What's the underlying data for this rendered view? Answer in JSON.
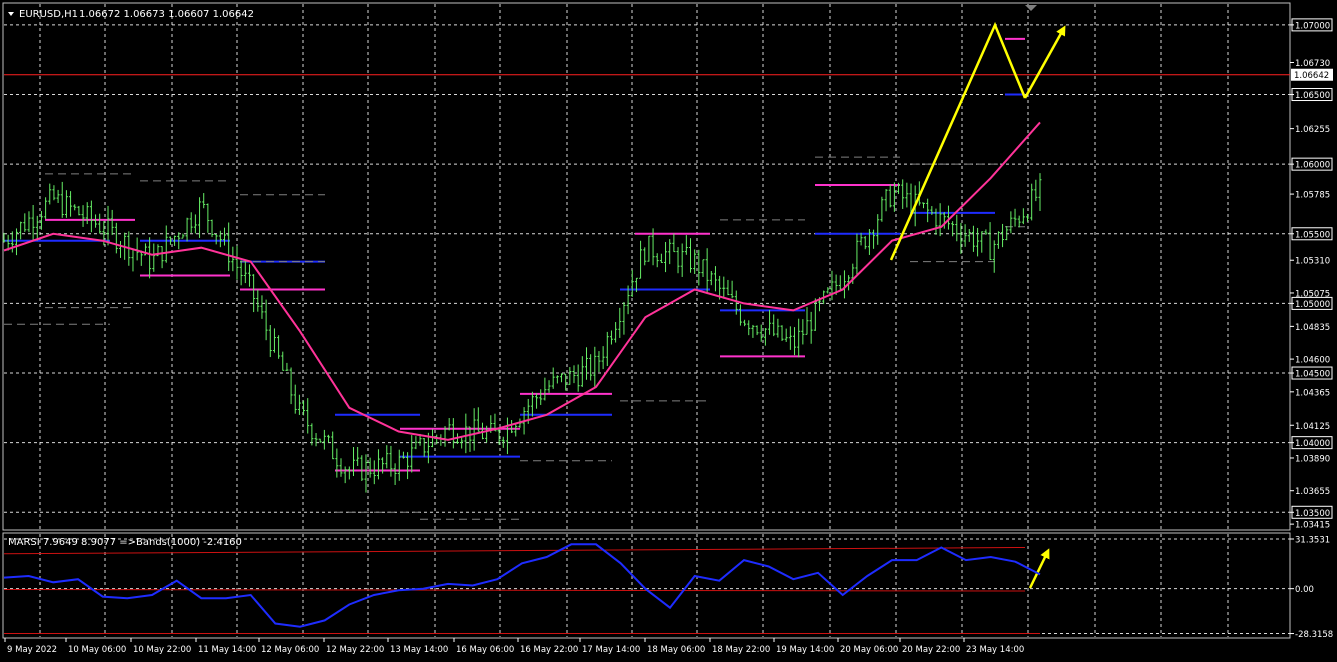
{
  "header": {
    "symbol": "EURUSD,H1",
    "ohlc": "1.06672 1.06673 1.06607 1.06642"
  },
  "colors": {
    "background": "#000000",
    "grid": "#ffffff",
    "candle": "#66ee66",
    "ma": "#ff3399",
    "level_magenta": "#ff33cc",
    "level_blue": "#1e2cff",
    "level_gray": "#808080",
    "arrow": "#ffff00",
    "bid_line": "#ff2020",
    "rsi": "#1e2cff",
    "band": "#cc1111"
  },
  "chart_data": [
    {
      "type": "candlestick",
      "title": "EURUSD,H1",
      "ylim": [
        1.0338,
        1.0715
      ],
      "x_ticks": [
        "9 May 2022",
        "10 May 06:00",
        "10 May 22:00",
        "11 May 14:00",
        "12 May 06:00",
        "12 May 22:00",
        "13 May 14:00",
        "16 May 06:00",
        "16 May 22:00",
        "17 May 14:00",
        "18 May 06:00",
        "18 May 22:00",
        "19 May 14:00",
        "20 May 06:00",
        "20 May 22:00",
        "23 May 14:00"
      ],
      "y_ticks": [
        "1.07000",
        "1.06730",
        "1.06500",
        "1.06255",
        "1.06000",
        "1.05785",
        "1.05500",
        "1.05310",
        "1.05075",
        "1.05000",
        "1.04835",
        "1.04600",
        "1.04500",
        "1.04365",
        "1.04125",
        "1.04000",
        "1.03890",
        "1.03655",
        "1.03500",
        "1.03415"
      ],
      "current_price": "1.06642",
      "x": [
        0,
        10,
        20,
        30,
        40,
        50,
        60,
        70,
        80,
        90,
        100,
        110,
        120,
        130,
        140,
        150,
        160,
        170,
        180,
        190,
        200,
        210
      ],
      "close": [
        1.0545,
        1.0575,
        1.0555,
        1.053,
        1.057,
        1.051,
        1.042,
        1.038,
        1.0385,
        1.041,
        1.0405,
        1.044,
        1.0455,
        1.054,
        1.053,
        1.049,
        1.047,
        1.052,
        1.058,
        1.056,
        1.054,
        1.058
      ],
      "series": [
        {
          "name": "",
          "type": "moving_average",
          "x": [
            0,
            10,
            20,
            30,
            40,
            50,
            60,
            70,
            80,
            90,
            100,
            110,
            120,
            130,
            140,
            150,
            160,
            170,
            180,
            190,
            200,
            210
          ],
          "values": [
            1.0538,
            1.055,
            1.0545,
            1.0535,
            1.054,
            1.053,
            1.048,
            1.0425,
            1.0408,
            1.0402,
            1.041,
            1.042,
            1.044,
            1.049,
            1.051,
            1.05,
            1.0495,
            1.051,
            1.0545,
            1.0555,
            1.059,
            1.063
          ]
        }
      ]
    },
    {
      "type": "line",
      "title": "MARSI 7.9649 8.9077  =>Bands(1000) -2.4160",
      "ylim": [
        -30.5,
        34.5
      ],
      "y_ticks": [
        "31.3531",
        "0.00",
        "-28.3158"
      ],
      "x": [
        0,
        5,
        10,
        15,
        20,
        25,
        30,
        35,
        40,
        45,
        50,
        55,
        60,
        65,
        70,
        75,
        80,
        85,
        90,
        95,
        100,
        105,
        110,
        115,
        120,
        125,
        130,
        135,
        140,
        145,
        150,
        155,
        160,
        165,
        170,
        175,
        180,
        185,
        190,
        195,
        200,
        205,
        210
      ],
      "series": [
        {
          "name": "",
          "values": [
            7,
            8,
            4,
            6,
            -5,
            -6,
            -4,
            5,
            -6,
            -6,
            -4,
            -22,
            -24,
            -20,
            -10,
            -4,
            -1,
            0,
            3,
            2,
            6,
            16,
            20,
            28,
            28,
            16,
            0,
            -12,
            8,
            5,
            18,
            14,
            6,
            10,
            -4,
            8,
            18,
            18,
            26,
            18,
            20,
            17,
            9
          ]
        },
        {
          "name": "",
          "values": [
            -28.3,
            -28.3,
            -28.3,
            -28.3,
            -28.3,
            -28.3,
            -28.3,
            -28.3,
            -28.3,
            -28.3,
            -28.3,
            -28.3,
            -28.3,
            -28.3,
            -28.3,
            -28.3,
            -28.3,
            -28.3,
            -28.3,
            -28.3,
            -28.3,
            -28.3,
            -28.3,
            -28.3,
            -28.3,
            -28.3,
            -28.3,
            -28.3,
            -28.3,
            -28.3,
            -28.3,
            -28.3,
            -28.3,
            -28.3,
            -28.3,
            -28.3,
            -28.3,
            -28.3,
            -28.3,
            -28.3,
            -28.3,
            -28.3,
            -28.3
          ]
        }
      ]
    }
  ]
}
